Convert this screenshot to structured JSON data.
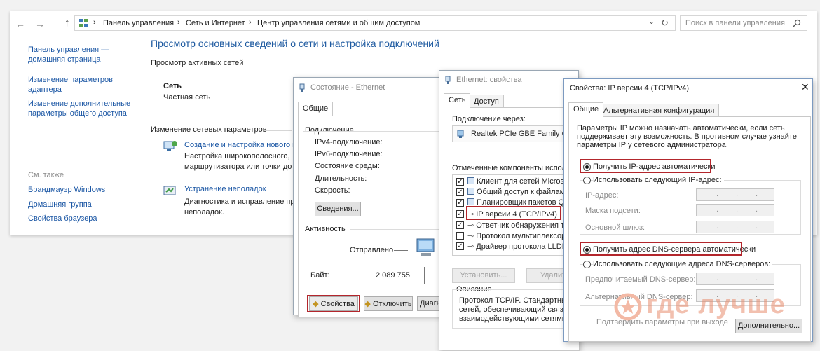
{
  "nav": {
    "back": "←",
    "forward": "→",
    "up": "↑",
    "breadcrumb": [
      "Панель управления",
      "Сеть и Интернет",
      "Центр управления сетями и общим доступом"
    ],
    "sep": "›",
    "refresh": "↻",
    "dropdown": "⌄",
    "search_placeholder": "Поиск в панели управления"
  },
  "sidebar": {
    "home": "Панель управления — домашняя страница",
    "links": [
      "Изменение параметров адаптера",
      "Изменение дополнительные параметры общего доступа"
    ],
    "see_also": "См. также",
    "see_also_links": [
      "Брандмауэр Windows",
      "Домашняя группа",
      "Свойства браузера"
    ]
  },
  "main": {
    "title": "Просмотр основных сведений о сети и настройка подключений",
    "active_networks": "Просмотр активных сетей",
    "network_name": "Сеть",
    "network_type": "Частная сеть",
    "change_settings": "Изменение сетевых параметров",
    "items": [
      {
        "title": "Создание и настройка нового п",
        "desc1": "Настройка широкополосного,",
        "desc2": "маршрутизатора или точки до"
      },
      {
        "title": "Устранение неполадок",
        "desc1": "Диагностика и исправление пр",
        "desc2": "неполадок."
      }
    ]
  },
  "status_dialog": {
    "title": "Состояние - Ethernet",
    "tab": "Общие",
    "connection_group": "Подключение",
    "rows": [
      "IPv4-подключение:",
      "IPv6-подключение:",
      "Состояние среды:",
      "Длительность:",
      "Скорость:"
    ],
    "details_btn": "Сведения...",
    "activity_group": "Активность",
    "sent": "Отправлено",
    "bytes_label": "Байт:",
    "bytes_value": "2 089 755",
    "buttons": [
      "Свойства",
      "Отключить",
      "Диагн"
    ]
  },
  "eth_dialog": {
    "title": "Ethernet: свойства",
    "tabs": [
      "Сеть",
      "Доступ"
    ],
    "connect_via": "Подключение через:",
    "adapter": "Realtek PCIe GBE Family Contr",
    "components_label": "Отмеченные компоненты использу",
    "components": [
      {
        "label": "Клиент для сетей Microsoft",
        "checked": true
      },
      {
        "label": "Общий доступ к файлам и",
        "checked": true
      },
      {
        "label": "Планировщик пакетов Qo",
        "checked": true
      },
      {
        "label": "IP версии 4 (TCP/IPv4)",
        "checked": true
      },
      {
        "label": "Ответчик обнаружения топ",
        "checked": true
      },
      {
        "label": "Протокол мультиплексора",
        "checked": false
      },
      {
        "label": "Драйвер протокола LLDP",
        "checked": true
      }
    ],
    "install_btn": "Установить...",
    "remove_btn": "Удалит",
    "description_label": "Описание",
    "description": [
      "Протокол TCP/IP. Стандартный",
      "сетей, обеспечивающий связь м",
      "взаимодействующими сетями."
    ]
  },
  "ipv4_dialog": {
    "title": "Свойства: IP версии 4 (TCP/IPv4)",
    "close": "✕",
    "tabs": [
      "Общие",
      "Альтернативная конфигурация"
    ],
    "info": [
      "Параметры IP можно назначать автоматически, если сеть",
      "поддерживает эту возможность. В противном случае узнайте",
      "параметры IP у сетевого администратора."
    ],
    "auto_ip": "Получить IP-адрес автоматически",
    "manual_ip": "Использовать следующий IP-адрес:",
    "ip_fields": [
      "IP-адрес:",
      "Маска подсети:",
      "Основной шлюз:"
    ],
    "auto_dns": "Получить адрес DNS-сервера автоматически",
    "manual_dns": "Использовать следующие адреса DNS-серверов:",
    "dns_fields": [
      "Предпочитаемый DNS-сервер:",
      "Альтернативный DNS-сервер:"
    ],
    "validate": "Подтвердить параметры при выходе",
    "advanced_btn": "Дополнительно..."
  },
  "watermark": "где лучше",
  "colors": {
    "link": "#1a56a4",
    "highlight": "#b3262c",
    "watermark": "#f3b9a5"
  }
}
